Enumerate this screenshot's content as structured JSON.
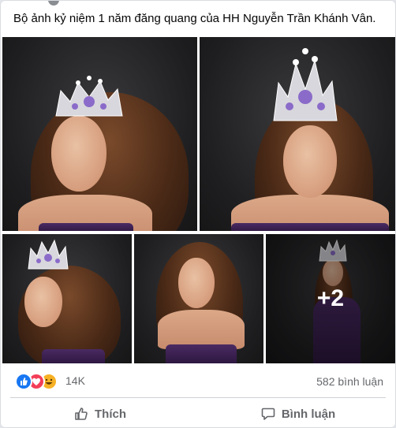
{
  "post": {
    "caption": "Bộ ảnh kỷ niệm 1 năm đăng quang của HH Nguyễn Trần Khánh Vân.",
    "photos": [
      {
        "description": "photo-1"
      },
      {
        "description": "photo-2"
      },
      {
        "description": "photo-3"
      },
      {
        "description": "photo-4"
      },
      {
        "description": "photo-5"
      }
    ],
    "more_photos_label": "+2"
  },
  "stats": {
    "reaction_icons": [
      "like-icon",
      "love-icon",
      "haha-icon"
    ],
    "reaction_count": "14K",
    "comment_count": "582 bình luận"
  },
  "actions": {
    "like_label": "Thích",
    "comment_label": "Bình luận"
  },
  "colors": {
    "like": "#1877f2",
    "love": "#f33e58",
    "haha": "#f7b125",
    "muted_text": "#65676b"
  }
}
